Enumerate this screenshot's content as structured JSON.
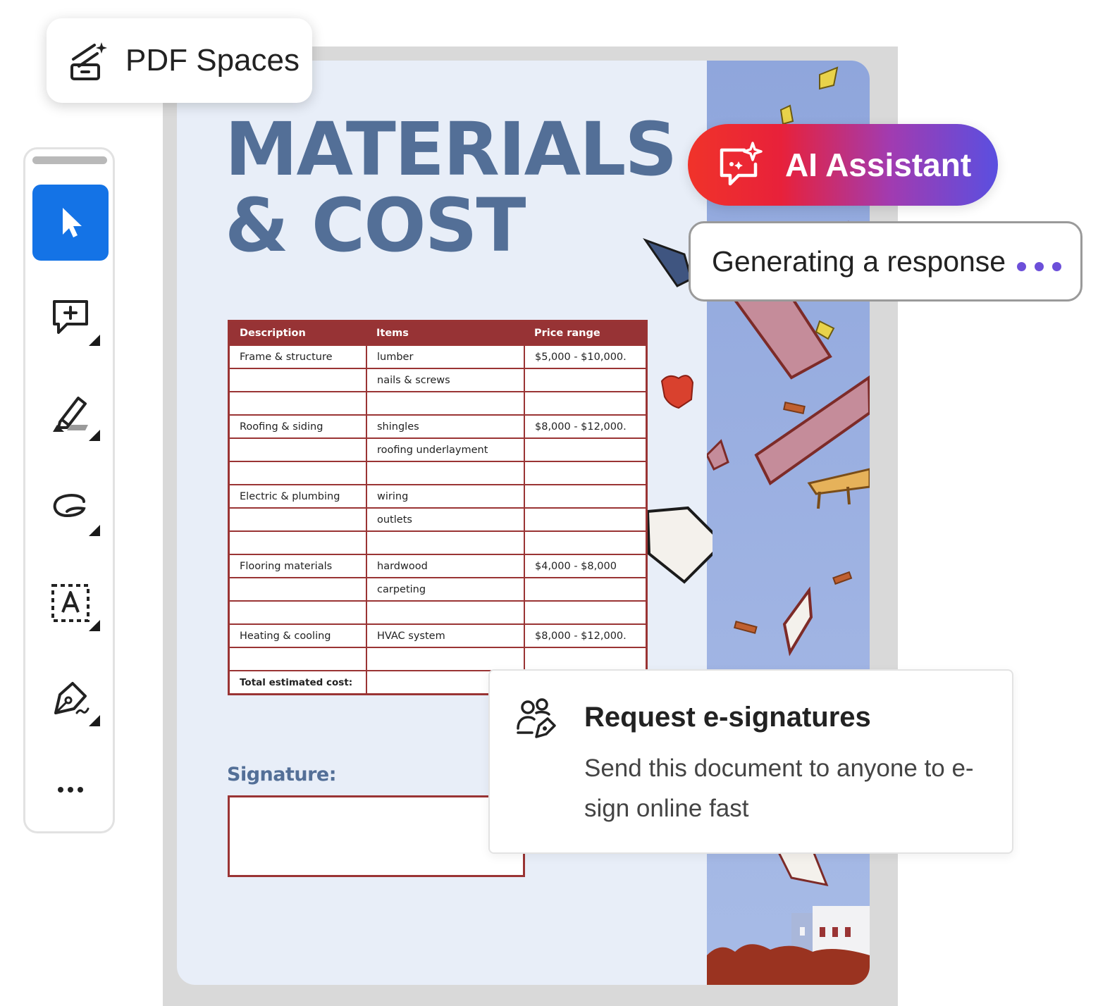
{
  "pdf_spaces": {
    "label": "PDF Spaces",
    "icon": "pdf-spaces-icon"
  },
  "toolbar": {
    "tools": [
      {
        "name": "select-tool",
        "icon": "cursor-icon",
        "active": true
      },
      {
        "name": "comment-tool",
        "icon": "add-comment-icon"
      },
      {
        "name": "highlight-tool",
        "icon": "highlighter-icon"
      },
      {
        "name": "draw-tool",
        "icon": "freehand-draw-icon"
      },
      {
        "name": "text-tool",
        "icon": "text-box-icon"
      },
      {
        "name": "sign-tool",
        "icon": "pen-sign-icon"
      },
      {
        "name": "more-tools",
        "icon": "more-icon"
      }
    ]
  },
  "document": {
    "title": "MATERIALS\n& COST",
    "table": {
      "headers": [
        "Description",
        "Items",
        "Price range"
      ],
      "rows": [
        [
          "Frame & structure",
          "lumber",
          "$5,000 - $10,000."
        ],
        [
          "",
          "nails & screws",
          ""
        ],
        [
          "",
          "",
          ""
        ],
        [
          "Roofing & siding",
          "shingles",
          "$8,000 - $12,000."
        ],
        [
          "",
          "roofing underlayment",
          ""
        ],
        [
          "",
          "",
          ""
        ],
        [
          "Electric & plumbing",
          "wiring",
          ""
        ],
        [
          "",
          "outlets",
          ""
        ],
        [
          "",
          "",
          ""
        ],
        [
          "Flooring materials",
          "hardwood",
          "$4,000 - $8,000"
        ],
        [
          "",
          "carpeting",
          ""
        ],
        [
          "",
          "",
          ""
        ],
        [
          "Heating & cooling",
          "HVAC system",
          "$8,000 - $12,000."
        ],
        [
          "",
          "",
          ""
        ]
      ],
      "total_label": "Total estimated cost:"
    },
    "signature_label": "Signature:"
  },
  "ai_assistant": {
    "label": "AI Assistant",
    "icon": "ai-chat-sparkle-icon"
  },
  "generating": {
    "label": "Generating a response"
  },
  "esign": {
    "title": "Request e-signatures",
    "description": "Send this document to anyone to e-sign online fast",
    "icon": "request-signature-icon"
  },
  "colors": {
    "accent_blue": "#1473e6",
    "title_blue": "#536f97",
    "table_red": "#973335",
    "ai_gradient_start": "#f0332a",
    "ai_gradient_end": "#5a4fe0",
    "dots_purple": "#6c4fd9"
  }
}
